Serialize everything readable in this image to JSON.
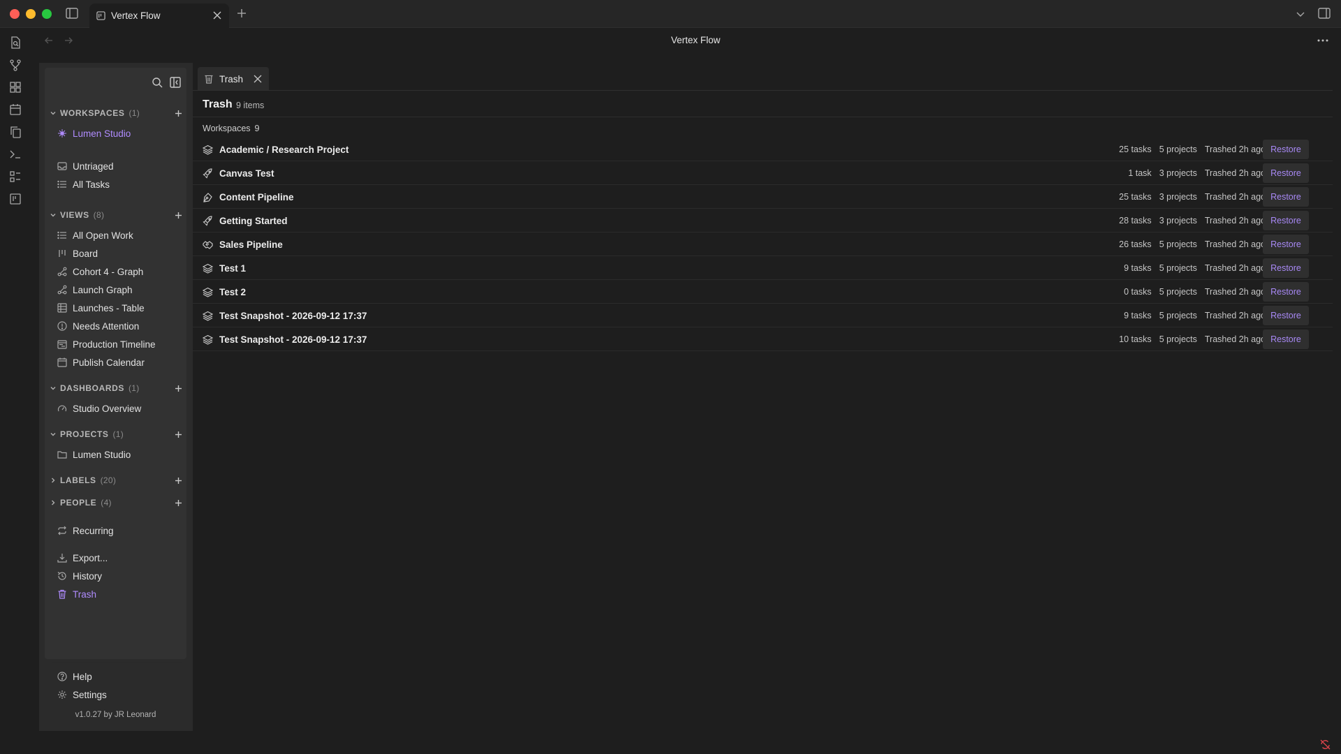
{
  "window": {
    "title": "Vertex Flow",
    "tab_title": "Vertex Flow"
  },
  "sidebar": {
    "sections": {
      "workspaces": {
        "label": "WORKSPACES",
        "count": "(1)"
      },
      "views": {
        "label": "VIEWS",
        "count": "(8)"
      },
      "dashboards": {
        "label": "DASHBOARDS",
        "count": "(1)"
      },
      "projects": {
        "label": "PROJECTS",
        "count": "(1)"
      },
      "labels": {
        "label": "LABELS",
        "count": "(20)"
      },
      "people": {
        "label": "PEOPLE",
        "count": "(4)"
      }
    },
    "workspace_item": "Lumen Studio",
    "untriaged": "Untriaged",
    "all_tasks": "All Tasks",
    "views": [
      "All Open Work",
      "Board",
      "Cohort 4 - Graph",
      "Launch Graph",
      "Launches - Table",
      "Needs Attention",
      "Production Timeline",
      "Publish Calendar"
    ],
    "dashboard_item": "Studio Overview",
    "project_item": "Lumen Studio",
    "recurring": "Recurring",
    "export": "Export...",
    "history": "History",
    "trash": "Trash",
    "help": "Help",
    "settings": "Settings",
    "version": "v1.0.27 by JR Leonard"
  },
  "main": {
    "tab_label": "Trash",
    "title": "Trash",
    "item_count": "9 items",
    "group_label": "Workspaces",
    "group_count": "9",
    "restore_label": "Restore",
    "rows": [
      {
        "icon": "layers-icon",
        "name": "Academic / Research Project",
        "tasks": "25 tasks",
        "projects": "5 projects",
        "trashed": "Trashed 2h ago"
      },
      {
        "icon": "rocket-icon",
        "name": "Canvas Test",
        "tasks": "1 task",
        "projects": "3 projects",
        "trashed": "Trashed 2h ago"
      },
      {
        "icon": "pen-tool-icon",
        "name": "Content Pipeline",
        "tasks": "25 tasks",
        "projects": "3 projects",
        "trashed": "Trashed 2h ago"
      },
      {
        "icon": "rocket-icon",
        "name": "Getting Started",
        "tasks": "28 tasks",
        "projects": "3 projects",
        "trashed": "Trashed 2h ago"
      },
      {
        "icon": "handshake-icon",
        "name": "Sales Pipeline",
        "tasks": "26 tasks",
        "projects": "5 projects",
        "trashed": "Trashed 2h ago"
      },
      {
        "icon": "layers-icon",
        "name": "Test 1",
        "tasks": "9 tasks",
        "projects": "5 projects",
        "trashed": "Trashed 2h ago"
      },
      {
        "icon": "layers-icon",
        "name": "Test 2",
        "tasks": "0 tasks",
        "projects": "5 projects",
        "trashed": "Trashed 2h ago"
      },
      {
        "icon": "layers-icon",
        "name": "Test Snapshot - 2026-09-12 17:37",
        "tasks": "9 tasks",
        "projects": "5 projects",
        "trashed": "Trashed 2h ago"
      },
      {
        "icon": "layers-icon",
        "name": "Test Snapshot - 2026-09-12 17:37",
        "tasks": "10 tasks",
        "projects": "5 projects",
        "trashed": "Trashed 2h ago"
      }
    ]
  },
  "colors": {
    "accent": "#b08cff",
    "restore": "#a889f5",
    "background": "#1e1e1e",
    "panel": "#323232"
  }
}
